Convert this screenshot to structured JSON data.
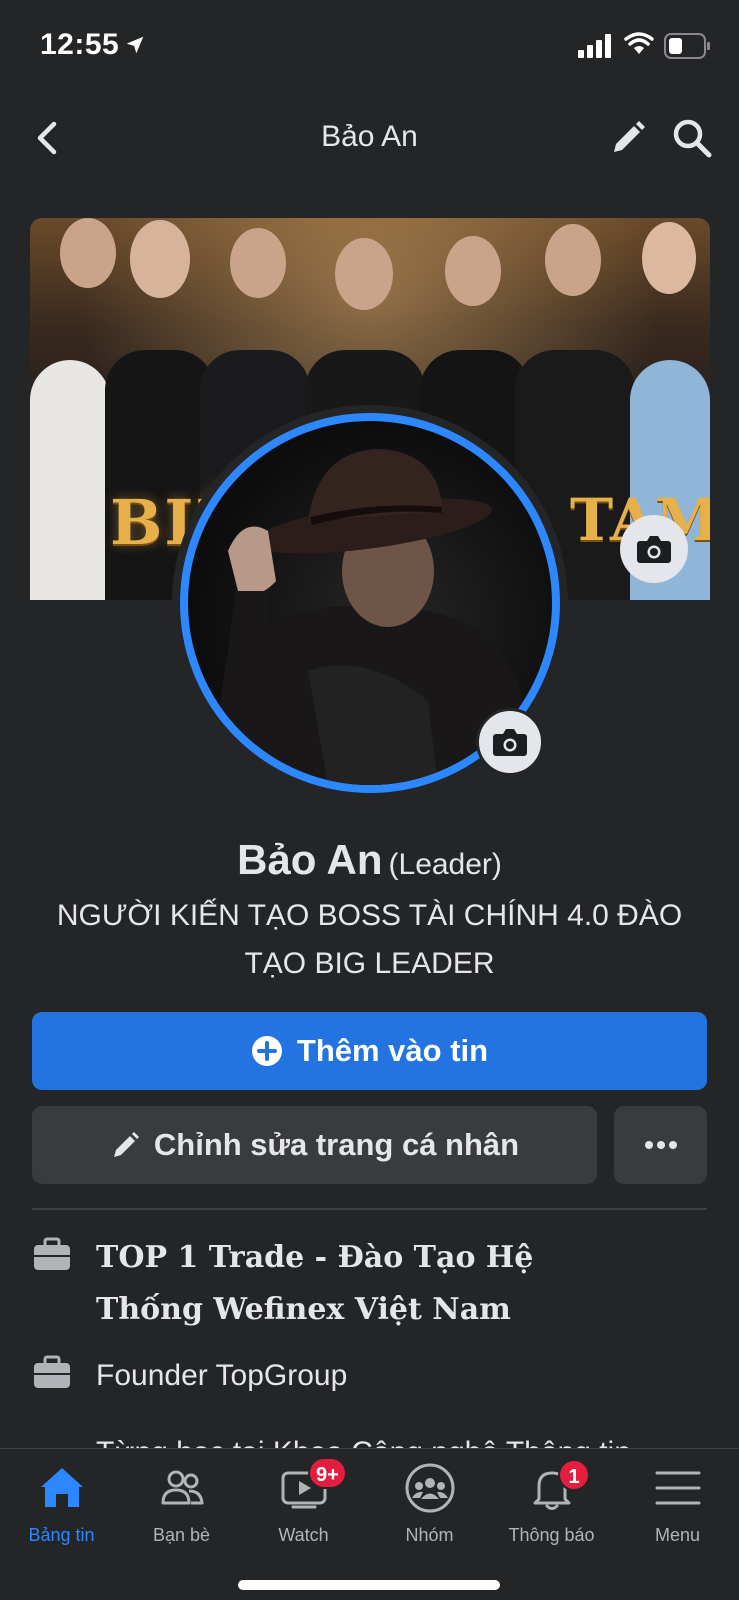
{
  "status_bar": {
    "time": "12:55"
  },
  "nav": {
    "title": "Bảo An"
  },
  "cover": {
    "text_left": "BIÊ",
    "text_right": "TAM"
  },
  "profile": {
    "name": "Bảo An",
    "alternate_name": "(Leader)",
    "bio": "NGƯỜI KIẾN TẠO BOSS TÀI CHÍNH 4.0 ĐÀO TẠO BIG LEADER"
  },
  "actions": {
    "add_story_label": "Thêm vào tin",
    "edit_profile_label": "Chỉnh sửa trang cá nhân"
  },
  "info": [
    {
      "icon": "briefcase-icon",
      "text": "TOP 1 Trade - Đào Tạo Hệ Thống Wefinex Việt Nam"
    },
    {
      "icon": "briefcase-icon",
      "text": "Founder TopGroup"
    }
  ],
  "info_partial": "Từng học tại Khoa Công nghệ Thông tin",
  "tabbar": {
    "items": [
      {
        "label": "Bảng tin",
        "icon": "home-icon",
        "active": true
      },
      {
        "label": "Bạn bè",
        "icon": "friends-icon"
      },
      {
        "label": "Watch",
        "icon": "watch-icon",
        "badge": "9+"
      },
      {
        "label": "Nhóm",
        "icon": "groups-icon"
      },
      {
        "label": "Thông báo",
        "icon": "bell-icon",
        "badge": "1"
      },
      {
        "label": "Menu",
        "icon": "menu-icon"
      }
    ]
  },
  "colors": {
    "accent": "#2374e1",
    "background": "#242526",
    "badge": "#e41e3f"
  }
}
